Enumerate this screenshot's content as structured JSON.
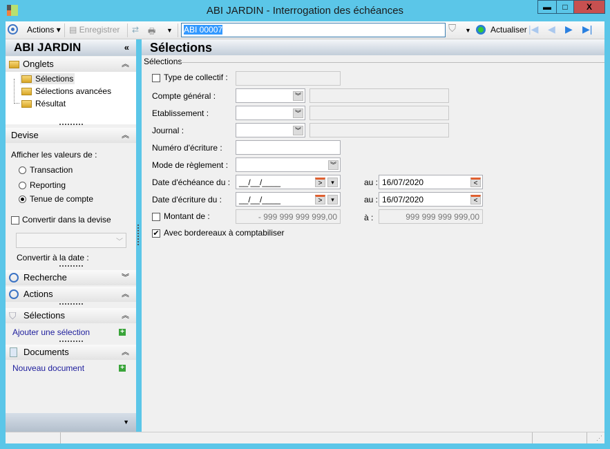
{
  "window": {
    "title": "ABI JARDIN -  Interrogation des échéances",
    "minimize": "▬",
    "maximize": "□",
    "close": "X"
  },
  "toolbar": {
    "actions": "Actions",
    "save": "Enregistrer",
    "record": "ABI 00007",
    "refresh": "Actualiser"
  },
  "sidebar": {
    "title": "ABI JARDIN",
    "collapse": "«",
    "onglets": {
      "label": "Onglets",
      "items": [
        "Sélections",
        "Sélections avancées",
        "Résultat"
      ]
    },
    "devise": {
      "label": "Devise",
      "prompt": "Afficher les valeurs de :",
      "options": [
        "Transaction",
        "Reporting",
        "Tenue de compte"
      ],
      "selected": 2,
      "convert_label": "Convertir dans la devise",
      "convert_checked": false,
      "convert_date_label": "Convertir à la date :"
    },
    "recherche": "Recherche",
    "actions": "Actions",
    "selections": {
      "label": "Sélections",
      "link": "Ajouter une sélection"
    },
    "documents": {
      "label": "Documents",
      "link": "Nouveau document"
    }
  },
  "main": {
    "title": "Sélections",
    "group": "Sélections",
    "fields": {
      "type_collectif": "Type de collectif :",
      "compte": "Compte général :",
      "etablissement": "Etablissement :",
      "journal": "Journal :",
      "numero": "Numéro d'écriture :",
      "mode": "Mode de règlement :",
      "date_ech": "Date d'échéance du :",
      "date_ecr": "Date d'écriture du :",
      "montant": "Montant de :",
      "bordereaux": "Avec bordereaux à comptabiliser",
      "au": "au :",
      "a": "à :",
      "date_empty": "__/__/____",
      "date_ech_to": "16/07/2020",
      "date_ecr_to": "16/07/2020",
      "montant_from": "- 999 999 999 999,00",
      "montant_to": "999 999 999 999,00",
      "bordereaux_checked": true
    }
  }
}
